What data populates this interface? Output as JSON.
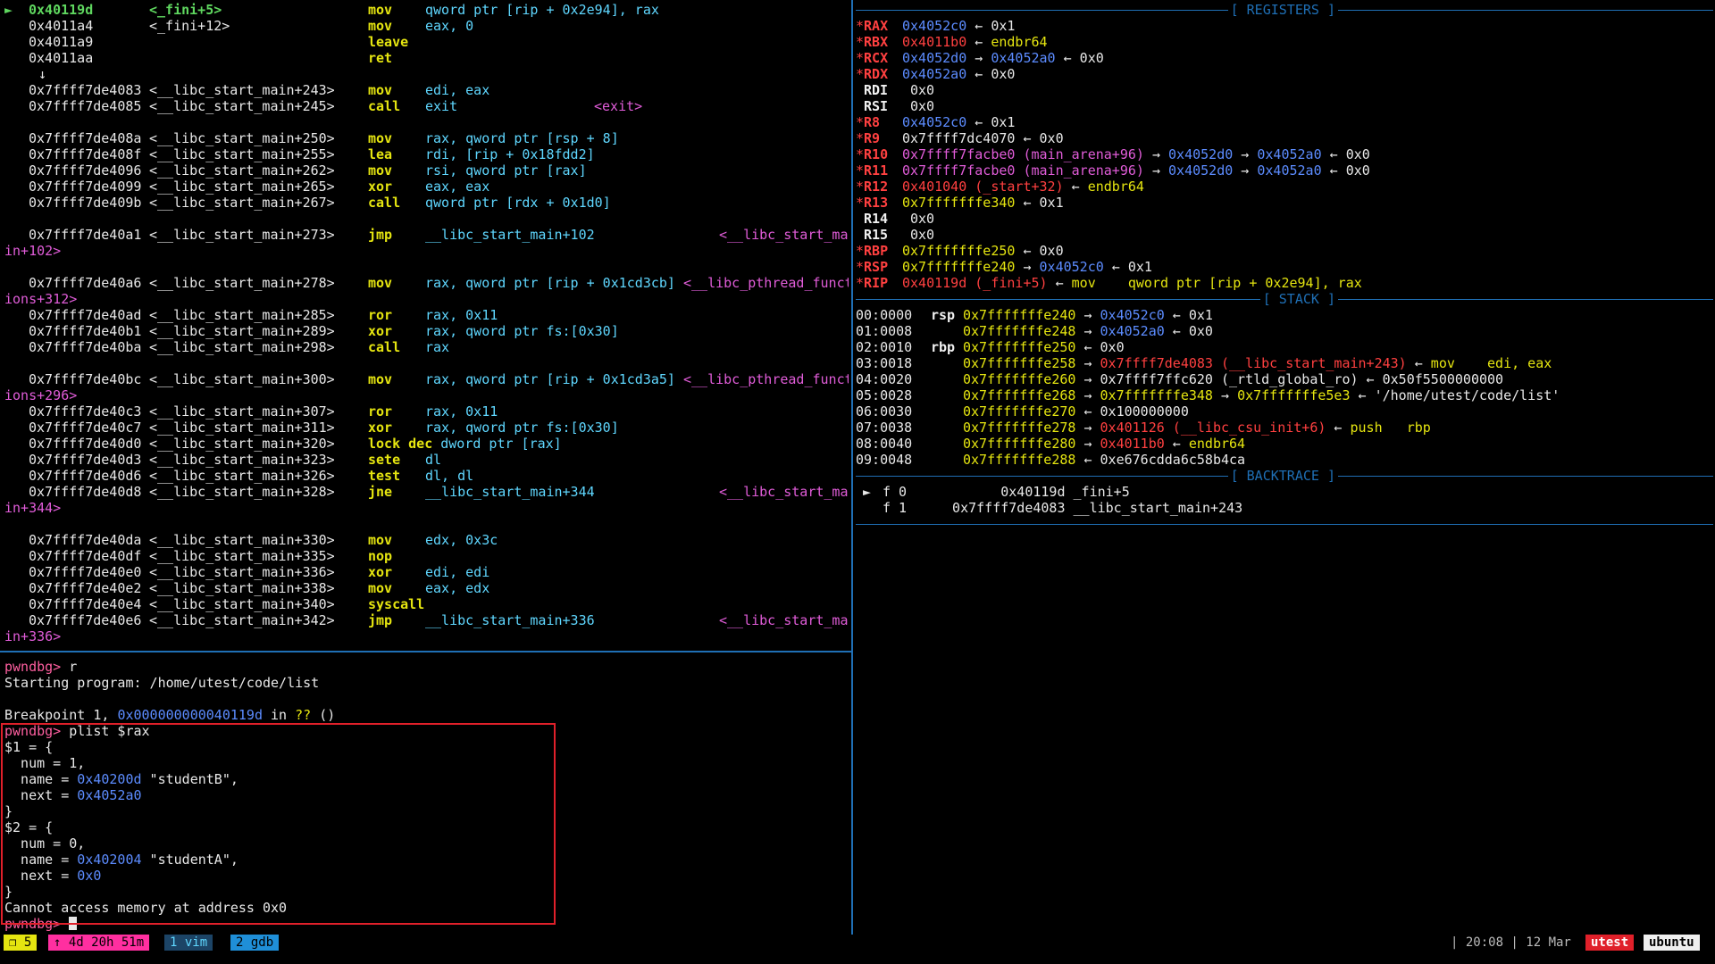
{
  "disasm": [
    {
      "ptr": "►",
      "addr": "0x40119d",
      "sym": "<_fini+5>",
      "mn": "mov",
      "ops": "qword ptr [rip + 0x2e94], rax",
      "current": true
    },
    {
      "addr": "0x4011a4",
      "sym": "<_fini+12>",
      "mn": "mov",
      "ops": "eax, 0"
    },
    {
      "addr": "0x4011a9",
      "mn": "leave"
    },
    {
      "addr": "0x4011aa",
      "mn": "ret"
    },
    {
      "arrow": "↓"
    },
    {
      "addr": "0x7ffff7de4083",
      "sym": "<__libc_start_main+243>",
      "mn": "mov",
      "ops": "edi, eax"
    },
    {
      "addr": "0x7ffff7de4085",
      "sym": "<__libc_start_main+245>",
      "mn": "call",
      "ops": "exit",
      "cmt": "<exit>",
      "cmtleft": "660px"
    },
    {
      "blank": true
    },
    {
      "addr": "0x7ffff7de408a",
      "sym": "<__libc_start_main+250>",
      "mn": "mov",
      "ops": "rax, qword ptr [rsp + 8]"
    },
    {
      "addr": "0x7ffff7de408f",
      "sym": "<__libc_start_main+255>",
      "mn": "lea",
      "ops": "rdi, [rip + 0x18fdd2]"
    },
    {
      "addr": "0x7ffff7de4096",
      "sym": "<__libc_start_main+262>",
      "mn": "mov",
      "ops": "rsi, qword ptr [rax]"
    },
    {
      "addr": "0x7ffff7de4099",
      "sym": "<__libc_start_main+265>",
      "mn": "xor",
      "ops": "eax, eax"
    },
    {
      "addr": "0x7ffff7de409b",
      "sym": "<__libc_start_main+267>",
      "mn": "call",
      "ops": "qword ptr [rdx + 0x1d0]"
    },
    {
      "blank": true
    },
    {
      "addr": "0x7ffff7de40a1",
      "sym": "<__libc_start_main+273>",
      "mn": "jmp",
      "ops": "__libc_start_main+102",
      "cmt": "<__libc_start_ma"
    },
    {
      "wrap": "in+102>"
    },
    {
      "blank": true
    },
    {
      "addr": "0x7ffff7de40a6",
      "sym": "<__libc_start_main+278>",
      "mn": "mov",
      "ops": "rax, qword ptr [rip + 0x1cd3cb]",
      "cmt": "<__libc_pthread_funct",
      "cmtleft": "760px"
    },
    {
      "wrap": "ions+312>"
    },
    {
      "addr": "0x7ffff7de40ad",
      "sym": "<__libc_start_main+285>",
      "mn": "ror",
      "ops": "rax, 0x11"
    },
    {
      "addr": "0x7ffff7de40b1",
      "sym": "<__libc_start_main+289>",
      "mn": "xor",
      "ops": "rax, qword ptr fs:[0x30]"
    },
    {
      "addr": "0x7ffff7de40ba",
      "sym": "<__libc_start_main+298>",
      "mn": "call",
      "ops": "rax"
    },
    {
      "blank": true
    },
    {
      "addr": "0x7ffff7de40bc",
      "sym": "<__libc_start_main+300>",
      "mn": "mov",
      "ops": "rax, qword ptr [rip + 0x1cd3a5]",
      "cmt": "<__libc_pthread_funct",
      "cmtleft": "760px"
    },
    {
      "wrap": "ions+296>"
    },
    {
      "addr": "0x7ffff7de40c3",
      "sym": "<__libc_start_main+307>",
      "mn": "ror",
      "ops": "rax, 0x11"
    },
    {
      "addr": "0x7ffff7de40c7",
      "sym": "<__libc_start_main+311>",
      "mn": "xor",
      "ops": "rax, qword ptr fs:[0x30]"
    },
    {
      "addr": "0x7ffff7de40d0",
      "sym": "<__libc_start_main+320>",
      "mn": "lock dec",
      "ops": "dword ptr [rax]",
      "mnwide": true
    },
    {
      "addr": "0x7ffff7de40d3",
      "sym": "<__libc_start_main+323>",
      "mn": "sete",
      "ops": "dl"
    },
    {
      "addr": "0x7ffff7de40d6",
      "sym": "<__libc_start_main+326>",
      "mn": "test",
      "ops": "dl, dl"
    },
    {
      "addr": "0x7ffff7de40d8",
      "sym": "<__libc_start_main+328>",
      "mn": "jne",
      "ops": "__libc_start_main+344",
      "cmt": "<__libc_start_ma"
    },
    {
      "wrap": "in+344>"
    },
    {
      "blank": true
    },
    {
      "addr": "0x7ffff7de40da",
      "sym": "<__libc_start_main+330>",
      "mn": "mov",
      "ops": "edx, 0x3c"
    },
    {
      "addr": "0x7ffff7de40df",
      "sym": "<__libc_start_main+335>",
      "mn": "nop"
    },
    {
      "addr": "0x7ffff7de40e0",
      "sym": "<__libc_start_main+336>",
      "mn": "xor",
      "ops": "edi, edi"
    },
    {
      "addr": "0x7ffff7de40e2",
      "sym": "<__libc_start_main+338>",
      "mn": "mov",
      "ops": "eax, edx"
    },
    {
      "addr": "0x7ffff7de40e4",
      "sym": "<__libc_start_main+340>",
      "mn": "syscall"
    },
    {
      "addr": "0x7ffff7de40e6",
      "sym": "<__libc_start_main+342>",
      "mn": "jmp",
      "ops": "__libc_start_main+336",
      "cmt": "<__libc_start_ma"
    },
    {
      "wrap": "in+336>"
    }
  ],
  "registers_title": "[ REGISTERS ]",
  "registers": [
    {
      "star": "*",
      "name": "RAX",
      "parts": [
        {
          "t": "0x4052c0",
          "c": "blue"
        },
        {
          "t": " ← 0x1"
        }
      ]
    },
    {
      "star": "*",
      "name": "RBX",
      "parts": [
        {
          "t": "0x4011b0",
          "c": "red"
        },
        {
          "t": " ← "
        },
        {
          "t": "endbr64",
          "c": "yellow"
        }
      ]
    },
    {
      "star": "*",
      "name": "RCX",
      "parts": [
        {
          "t": "0x4052d0",
          "c": "blue"
        },
        {
          "t": " → "
        },
        {
          "t": "0x4052a0",
          "c": "blue"
        },
        {
          "t": " ← 0x0"
        }
      ]
    },
    {
      "star": "*",
      "name": "RDX",
      "parts": [
        {
          "t": "0x4052a0",
          "c": "blue"
        },
        {
          "t": " ← 0x0"
        }
      ]
    },
    {
      "star": "",
      "name": "RDI",
      "parts": [
        {
          "t": "0x0"
        }
      ]
    },
    {
      "star": "",
      "name": "RSI",
      "parts": [
        {
          "t": "0x0"
        }
      ]
    },
    {
      "star": "*",
      "name": "R8",
      "parts": [
        {
          "t": "0x4052c0",
          "c": "blue"
        },
        {
          "t": " ← 0x1"
        }
      ]
    },
    {
      "star": "*",
      "name": "R9",
      "parts": [
        {
          "t": "0x7ffff7dc4070 ← 0x0"
        }
      ]
    },
    {
      "star": "*",
      "name": "R10",
      "parts": [
        {
          "t": "0x7ffff7facbe0 (main_arena+96)",
          "c": "magenta"
        },
        {
          "t": " → "
        },
        {
          "t": "0x4052d0",
          "c": "blue"
        },
        {
          "t": " → "
        },
        {
          "t": "0x4052a0",
          "c": "blue"
        },
        {
          "t": " ← 0x0"
        }
      ]
    },
    {
      "star": "*",
      "name": "R11",
      "parts": [
        {
          "t": "0x7ffff7facbe0 (main_arena+96)",
          "c": "magenta"
        },
        {
          "t": " → "
        },
        {
          "t": "0x4052d0",
          "c": "blue"
        },
        {
          "t": " → "
        },
        {
          "t": "0x4052a0",
          "c": "blue"
        },
        {
          "t": " ← 0x0"
        }
      ]
    },
    {
      "star": "*",
      "name": "R12",
      "parts": [
        {
          "t": "0x401040 (_start+32)",
          "c": "red"
        },
        {
          "t": " ← "
        },
        {
          "t": "endbr64",
          "c": "yellow"
        }
      ]
    },
    {
      "star": "*",
      "name": "R13",
      "parts": [
        {
          "t": "0x7fffffffe340",
          "c": "yellow"
        },
        {
          "t": " ← 0x1"
        }
      ]
    },
    {
      "star": "",
      "name": "R14",
      "parts": [
        {
          "t": "0x0"
        }
      ]
    },
    {
      "star": "",
      "name": "R15",
      "parts": [
        {
          "t": "0x0"
        }
      ]
    },
    {
      "star": "*",
      "name": "RBP",
      "parts": [
        {
          "t": "0x7fffffffe250",
          "c": "yellow"
        },
        {
          "t": " ← 0x0"
        }
      ]
    },
    {
      "star": "*",
      "name": "RSP",
      "parts": [
        {
          "t": "0x7fffffffe240",
          "c": "yellow"
        },
        {
          "t": " → "
        },
        {
          "t": "0x4052c0",
          "c": "blue"
        },
        {
          "t": " ← 0x1"
        }
      ]
    },
    {
      "star": "*",
      "name": "RIP",
      "parts": [
        {
          "t": "0x40119d (_fini+5)",
          "c": "red"
        },
        {
          "t": " ← "
        },
        {
          "t": "mov    qword ptr [rip + 0x2e94], rax",
          "c": "yellow"
        }
      ]
    }
  ],
  "stack_title": "[ STACK ]",
  "stack": [
    {
      "off": "00:0000",
      "reg": "rsp",
      "parts": [
        {
          "t": "0x7fffffffe240",
          "c": "yellow"
        },
        {
          "t": " → "
        },
        {
          "t": "0x4052c0",
          "c": "blue"
        },
        {
          "t": " ← 0x1"
        }
      ]
    },
    {
      "off": "01:0008",
      "reg": "",
      "parts": [
        {
          "t": "0x7fffffffe248",
          "c": "yellow"
        },
        {
          "t": " → "
        },
        {
          "t": "0x4052a0",
          "c": "blue"
        },
        {
          "t": " ← 0x0"
        }
      ]
    },
    {
      "off": "02:0010",
      "reg": "rbp",
      "parts": [
        {
          "t": "0x7fffffffe250",
          "c": "yellow"
        },
        {
          "t": " ← 0x0"
        }
      ]
    },
    {
      "off": "03:0018",
      "reg": "",
      "parts": [
        {
          "t": "0x7fffffffe258",
          "c": "yellow"
        },
        {
          "t": " → "
        },
        {
          "t": "0x7ffff7de4083 (__libc_start_main+243)",
          "c": "red"
        },
        {
          "t": " ← "
        },
        {
          "t": "mov    edi, eax",
          "c": "yellow"
        }
      ]
    },
    {
      "off": "04:0020",
      "reg": "",
      "parts": [
        {
          "t": "0x7fffffffe260",
          "c": "yellow"
        },
        {
          "t": " → 0x7ffff7ffc620 (_rtld_global_ro) ← 0x50f5500000000"
        }
      ]
    },
    {
      "off": "05:0028",
      "reg": "",
      "parts": [
        {
          "t": "0x7fffffffe268",
          "c": "yellow"
        },
        {
          "t": " → "
        },
        {
          "t": "0x7fffffffe348",
          "c": "yellow"
        },
        {
          "t": " → "
        },
        {
          "t": "0x7fffffffe5e3",
          "c": "yellow"
        },
        {
          "t": " ← '/home/utest/code/list'"
        }
      ]
    },
    {
      "off": "06:0030",
      "reg": "",
      "parts": [
        {
          "t": "0x7fffffffe270",
          "c": "yellow"
        },
        {
          "t": " ← 0x100000000"
        }
      ]
    },
    {
      "off": "07:0038",
      "reg": "",
      "parts": [
        {
          "t": "0x7fffffffe278",
          "c": "yellow"
        },
        {
          "t": " → "
        },
        {
          "t": "0x401126 (__libc_csu_init+6)",
          "c": "red"
        },
        {
          "t": " ← "
        },
        {
          "t": "push   rbp",
          "c": "yellow"
        }
      ]
    },
    {
      "off": "08:0040",
      "reg": "",
      "parts": [
        {
          "t": "0x7fffffffe280",
          "c": "yellow"
        },
        {
          "t": " → "
        },
        {
          "t": "0x4011b0",
          "c": "red"
        },
        {
          "t": " ← "
        },
        {
          "t": "endbr64",
          "c": "yellow"
        }
      ]
    },
    {
      "off": "09:0048",
      "reg": "",
      "parts": [
        {
          "t": "0x7fffffffe288",
          "c": "yellow"
        },
        {
          "t": " ← 0xe676cdda6c58b4ca"
        }
      ]
    }
  ],
  "backtrace_title": "[ BACKTRACE ]",
  "backtrace": [
    {
      "mark": "►",
      "frame": "f 0",
      "addr": "        0x40119d",
      "sym": " _fini+5"
    },
    {
      "mark": "",
      "frame": "f 1",
      "addr": "  0x7ffff7de4083",
      "sym": " __libc_start_main+243"
    }
  ],
  "console": [
    [
      {
        "t": "pwndbg> ",
        "c": "pink"
      },
      {
        "t": "r"
      }
    ],
    [
      {
        "t": "Starting program: /home/utest/code/list"
      }
    ],
    [
      {
        "t": ""
      }
    ],
    [
      {
        "t": "Breakpoint 1, "
      },
      {
        "t": "0x000000000040119d",
        "c": "blue"
      },
      {
        "t": " in "
      },
      {
        "t": "??",
        "c": "yellow"
      },
      {
        "t": " ()"
      }
    ],
    [
      {
        "t": "pwndbg> ",
        "c": "pink"
      },
      {
        "t": "plist $rax"
      }
    ],
    [
      {
        "t": "$1 = {"
      }
    ],
    [
      {
        "t": "  num = 1,"
      }
    ],
    [
      {
        "t": "  name = "
      },
      {
        "t": "0x40200d",
        "c": "blue"
      },
      {
        "t": " \"studentB\","
      }
    ],
    [
      {
        "t": "  next = "
      },
      {
        "t": "0x4052a0",
        "c": "blue"
      }
    ],
    [
      {
        "t": "}"
      }
    ],
    [
      {
        "t": "$2 = {"
      }
    ],
    [
      {
        "t": "  num = 0,"
      }
    ],
    [
      {
        "t": "  name = "
      },
      {
        "t": "0x402004",
        "c": "blue"
      },
      {
        "t": " \"studentA\","
      }
    ],
    [
      {
        "t": "  next = "
      },
      {
        "t": "0x0",
        "c": "blue"
      }
    ],
    [
      {
        "t": "}"
      }
    ],
    [
      {
        "t": "Cannot access memory at address 0x0"
      }
    ],
    [
      {
        "t": "pwndbg> ",
        "c": "pink"
      }
    ]
  ],
  "status": {
    "session": "❐ 5",
    "uptime": "↑ 4d 20h 51m",
    "win1": "1 vim",
    "win2": "2 gdb",
    "clock": "| 20:08 | 12 Mar",
    "user": "utest",
    "host": "ubuntu"
  },
  "colors": {
    "separator": "#1f6fb5",
    "highlight_box": "#e0202a"
  }
}
